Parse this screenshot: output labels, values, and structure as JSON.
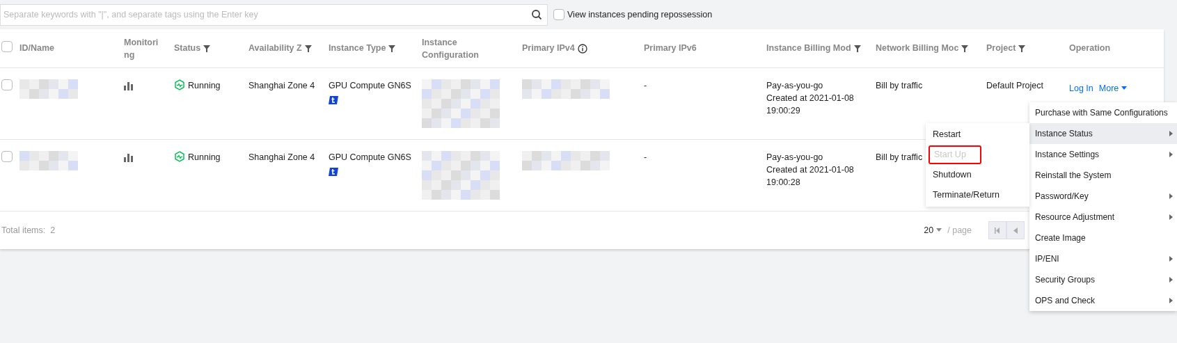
{
  "search": {
    "placeholder": "Separate keywords with \"|\", and separate tags using the Enter key"
  },
  "pending_filter": {
    "label": "View instances pending repossession",
    "checked": false
  },
  "table": {
    "select_all": {
      "checked": false
    },
    "columns": [
      {
        "label": "ID/Name",
        "kind": "plain"
      },
      {
        "label": "Monitoring",
        "kind": "plain"
      },
      {
        "label": "Status",
        "kind": "filterable"
      },
      {
        "label": "Availability Z",
        "kind": "filterable"
      },
      {
        "label": "Instance Type",
        "kind": "filterable"
      },
      {
        "label": "Instance Configuration",
        "kind": "plain"
      },
      {
        "label": "Primary IPv4",
        "kind": "info"
      },
      {
        "label": "Primary IPv6",
        "kind": "plain"
      },
      {
        "label": "Instance Billing Mod",
        "kind": "filterable"
      },
      {
        "label": "Network Billing Moc",
        "kind": "filterable"
      },
      {
        "label": "Project",
        "kind": "filterable"
      },
      {
        "label": "Operation",
        "kind": "plain"
      }
    ],
    "rows": [
      {
        "checked": false,
        "status": "Running",
        "zone": "Shanghai Zone 4",
        "instance_type": "GPU Compute GN6S",
        "ipv6": "-",
        "billing": [
          "Pay-as-you-go",
          "Created at 2021-01-08",
          "19:00:29"
        ],
        "network_billing": "Bill by traffic",
        "project": "Default Project",
        "actions": [
          "Log In",
          "More"
        ]
      },
      {
        "checked": false,
        "status": "Running",
        "zone": "Shanghai Zone 4",
        "instance_type": "GPU Compute GN6S",
        "ipv6": "-",
        "billing": [
          "Pay-as-you-go",
          "Created at 2021-01-08",
          "19:00:28"
        ],
        "network_billing": "Bill by traffic"
      }
    ],
    "total": "Total items:  2",
    "page_size": "20",
    "page_unit": "/ page"
  },
  "more_menu": [
    {
      "label": "Purchase with Same Configurations",
      "submenu": false,
      "selected": false
    },
    {
      "label": "Instance Status",
      "submenu": true,
      "selected": true
    },
    {
      "label": "Instance Settings",
      "submenu": true,
      "selected": false
    },
    {
      "label": "Reinstall the System",
      "submenu": false,
      "selected": false
    },
    {
      "label": "Password/Key",
      "submenu": true,
      "selected": false
    },
    {
      "label": "Resource Adjustment",
      "submenu": true,
      "selected": false
    },
    {
      "label": "Create Image",
      "submenu": false,
      "selected": false
    },
    {
      "label": "IP/ENI",
      "submenu": true,
      "selected": false
    },
    {
      "label": "Security Groups",
      "submenu": true,
      "selected": false
    },
    {
      "label": "OPS and Check",
      "submenu": true,
      "selected": false
    }
  ],
  "status_submenu": [
    {
      "label": "Restart",
      "disabled": false,
      "highlighted": false
    },
    {
      "label": "Start Up",
      "disabled": true,
      "highlighted": true
    },
    {
      "label": "Shutdown",
      "disabled": false,
      "highlighted": false
    },
    {
      "label": "Terminate/Return",
      "disabled": false,
      "highlighted": false
    }
  ]
}
